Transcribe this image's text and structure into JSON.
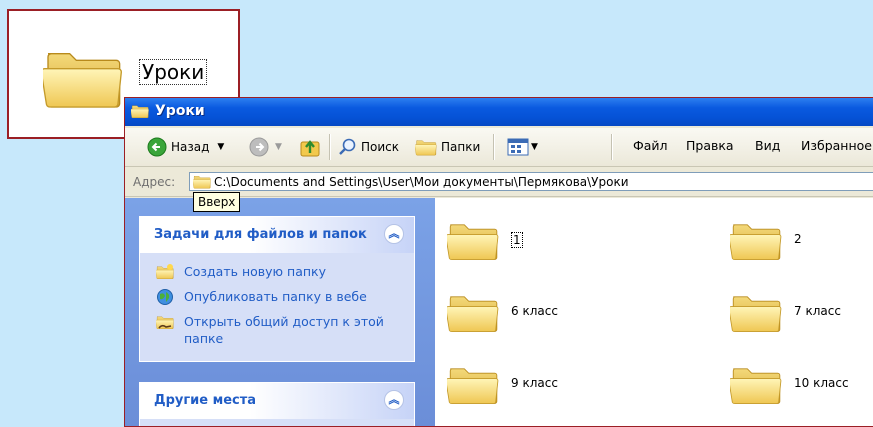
{
  "callout": {
    "folder_label": "Уроки"
  },
  "window": {
    "title": "Уроки",
    "toolbar": {
      "back": "Назад",
      "search": "Поиск",
      "folders": "Папки"
    },
    "menu": {
      "file": "Файл",
      "edit": "Правка",
      "view": "Вид",
      "favorites": "Избранное"
    },
    "address": {
      "label": "Адрес:",
      "path": "C:\\Documents and Settings\\User\\Мои документы\\Пермякова\\Уроки"
    },
    "tooltip": "Вверх",
    "tasks_panel": {
      "title": "Задачи для файлов и папок",
      "items": [
        {
          "label": "Создать новую папку",
          "icon": "new-folder-icon"
        },
        {
          "label": "Опубликовать папку в вебе",
          "icon": "globe-icon"
        },
        {
          "label": "Открыть общий доступ к этой папке",
          "icon": "share-folder-icon"
        }
      ]
    },
    "places_panel": {
      "title": "Другие места"
    },
    "folders": [
      {
        "name": "1",
        "selected": true
      },
      {
        "name": "2"
      },
      {
        "name": "6 класс"
      },
      {
        "name": "7 класс"
      },
      {
        "name": "9 класс"
      },
      {
        "name": "10 класс"
      }
    ]
  },
  "colors": {
    "background": "#c7e8fb",
    "titlebar": "#0a5ae0",
    "callout_border": "#9b1f25",
    "task_link": "#215dc6"
  }
}
